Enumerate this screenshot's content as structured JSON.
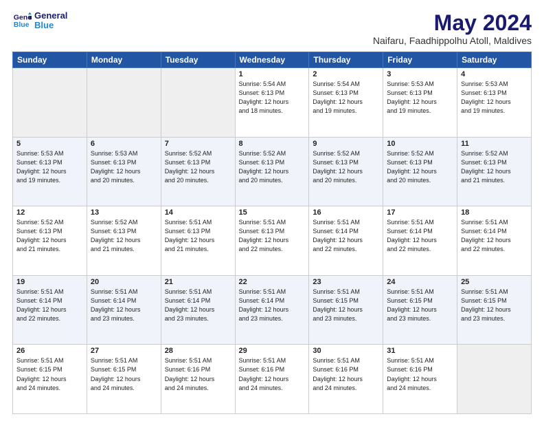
{
  "logo": {
    "line1": "General",
    "line2": "Blue"
  },
  "title": "May 2024",
  "subtitle": "Naifaru, Faadhippolhu Atoll, Maldives",
  "weekdays": [
    "Sunday",
    "Monday",
    "Tuesday",
    "Wednesday",
    "Thursday",
    "Friday",
    "Saturday"
  ],
  "weeks": [
    [
      {
        "day": "",
        "info": ""
      },
      {
        "day": "",
        "info": ""
      },
      {
        "day": "",
        "info": ""
      },
      {
        "day": "1",
        "info": "Sunrise: 5:54 AM\nSunset: 6:13 PM\nDaylight: 12 hours\nand 18 minutes."
      },
      {
        "day": "2",
        "info": "Sunrise: 5:54 AM\nSunset: 6:13 PM\nDaylight: 12 hours\nand 19 minutes."
      },
      {
        "day": "3",
        "info": "Sunrise: 5:53 AM\nSunset: 6:13 PM\nDaylight: 12 hours\nand 19 minutes."
      },
      {
        "day": "4",
        "info": "Sunrise: 5:53 AM\nSunset: 6:13 PM\nDaylight: 12 hours\nand 19 minutes."
      }
    ],
    [
      {
        "day": "5",
        "info": "Sunrise: 5:53 AM\nSunset: 6:13 PM\nDaylight: 12 hours\nand 19 minutes."
      },
      {
        "day": "6",
        "info": "Sunrise: 5:53 AM\nSunset: 6:13 PM\nDaylight: 12 hours\nand 20 minutes."
      },
      {
        "day": "7",
        "info": "Sunrise: 5:52 AM\nSunset: 6:13 PM\nDaylight: 12 hours\nand 20 minutes."
      },
      {
        "day": "8",
        "info": "Sunrise: 5:52 AM\nSunset: 6:13 PM\nDaylight: 12 hours\nand 20 minutes."
      },
      {
        "day": "9",
        "info": "Sunrise: 5:52 AM\nSunset: 6:13 PM\nDaylight: 12 hours\nand 20 minutes."
      },
      {
        "day": "10",
        "info": "Sunrise: 5:52 AM\nSunset: 6:13 PM\nDaylight: 12 hours\nand 20 minutes."
      },
      {
        "day": "11",
        "info": "Sunrise: 5:52 AM\nSunset: 6:13 PM\nDaylight: 12 hours\nand 21 minutes."
      }
    ],
    [
      {
        "day": "12",
        "info": "Sunrise: 5:52 AM\nSunset: 6:13 PM\nDaylight: 12 hours\nand 21 minutes."
      },
      {
        "day": "13",
        "info": "Sunrise: 5:52 AM\nSunset: 6:13 PM\nDaylight: 12 hours\nand 21 minutes."
      },
      {
        "day": "14",
        "info": "Sunrise: 5:51 AM\nSunset: 6:13 PM\nDaylight: 12 hours\nand 21 minutes."
      },
      {
        "day": "15",
        "info": "Sunrise: 5:51 AM\nSunset: 6:13 PM\nDaylight: 12 hours\nand 22 minutes."
      },
      {
        "day": "16",
        "info": "Sunrise: 5:51 AM\nSunset: 6:14 PM\nDaylight: 12 hours\nand 22 minutes."
      },
      {
        "day": "17",
        "info": "Sunrise: 5:51 AM\nSunset: 6:14 PM\nDaylight: 12 hours\nand 22 minutes."
      },
      {
        "day": "18",
        "info": "Sunrise: 5:51 AM\nSunset: 6:14 PM\nDaylight: 12 hours\nand 22 minutes."
      }
    ],
    [
      {
        "day": "19",
        "info": "Sunrise: 5:51 AM\nSunset: 6:14 PM\nDaylight: 12 hours\nand 22 minutes."
      },
      {
        "day": "20",
        "info": "Sunrise: 5:51 AM\nSunset: 6:14 PM\nDaylight: 12 hours\nand 23 minutes."
      },
      {
        "day": "21",
        "info": "Sunrise: 5:51 AM\nSunset: 6:14 PM\nDaylight: 12 hours\nand 23 minutes."
      },
      {
        "day": "22",
        "info": "Sunrise: 5:51 AM\nSunset: 6:14 PM\nDaylight: 12 hours\nand 23 minutes."
      },
      {
        "day": "23",
        "info": "Sunrise: 5:51 AM\nSunset: 6:15 PM\nDaylight: 12 hours\nand 23 minutes."
      },
      {
        "day": "24",
        "info": "Sunrise: 5:51 AM\nSunset: 6:15 PM\nDaylight: 12 hours\nand 23 minutes."
      },
      {
        "day": "25",
        "info": "Sunrise: 5:51 AM\nSunset: 6:15 PM\nDaylight: 12 hours\nand 23 minutes."
      }
    ],
    [
      {
        "day": "26",
        "info": "Sunrise: 5:51 AM\nSunset: 6:15 PM\nDaylight: 12 hours\nand 24 minutes."
      },
      {
        "day": "27",
        "info": "Sunrise: 5:51 AM\nSunset: 6:15 PM\nDaylight: 12 hours\nand 24 minutes."
      },
      {
        "day": "28",
        "info": "Sunrise: 5:51 AM\nSunset: 6:16 PM\nDaylight: 12 hours\nand 24 minutes."
      },
      {
        "day": "29",
        "info": "Sunrise: 5:51 AM\nSunset: 6:16 PM\nDaylight: 12 hours\nand 24 minutes."
      },
      {
        "day": "30",
        "info": "Sunrise: 5:51 AM\nSunset: 6:16 PM\nDaylight: 12 hours\nand 24 minutes."
      },
      {
        "day": "31",
        "info": "Sunrise: 5:51 AM\nSunset: 6:16 PM\nDaylight: 12 hours\nand 24 minutes."
      },
      {
        "day": "",
        "info": ""
      }
    ]
  ]
}
